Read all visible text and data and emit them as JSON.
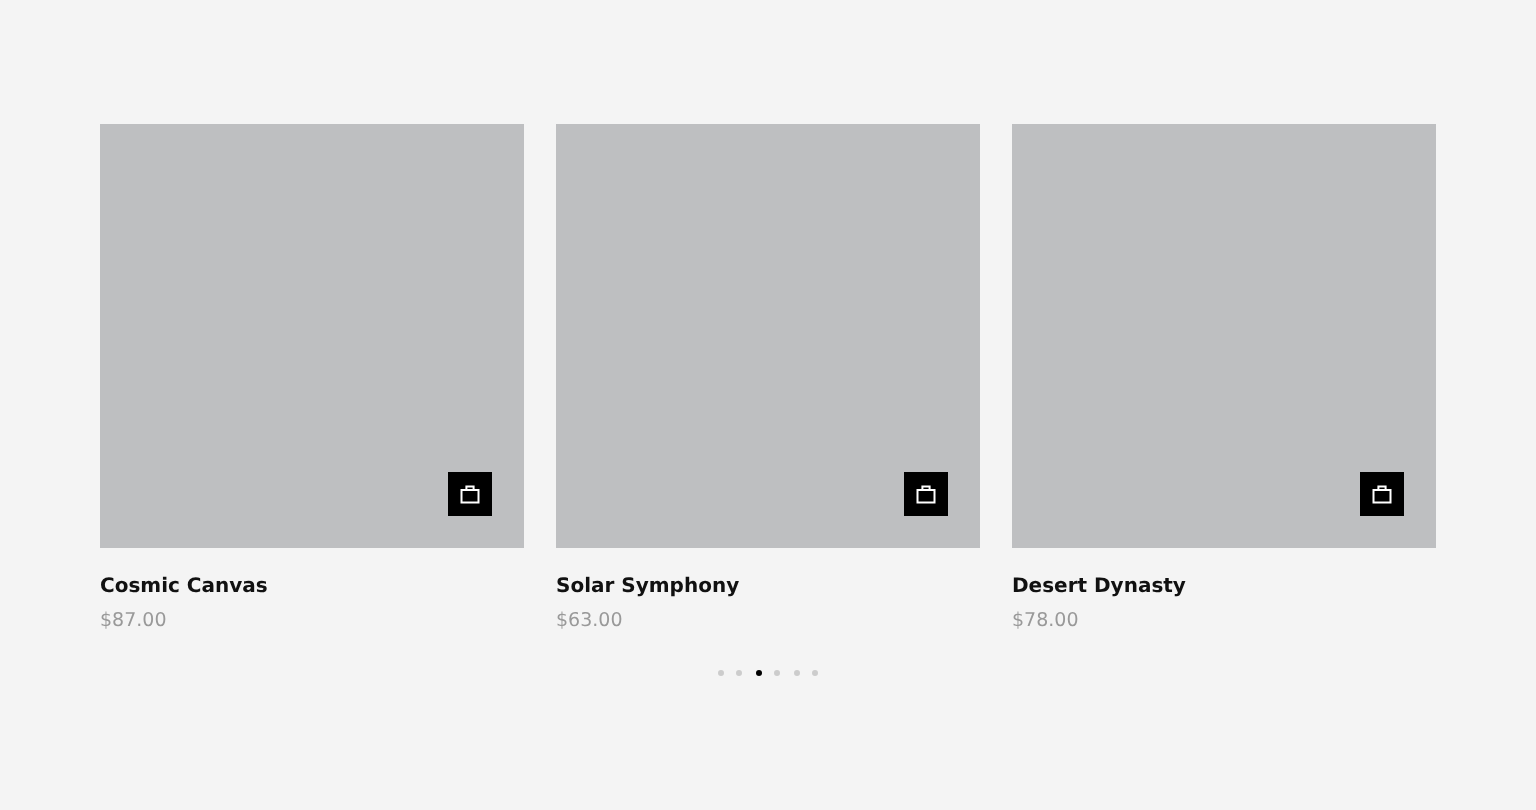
{
  "products": [
    {
      "name": "Cosmic Canvas",
      "price": "$87.00"
    },
    {
      "name": "Solar Symphony",
      "price": "$63.00"
    },
    {
      "name": "Desert Dynasty",
      "price": "$78.00"
    }
  ],
  "pagination": [
    {
      "selected": false
    },
    {
      "selected": false
    },
    {
      "selected": true
    },
    {
      "selected": false
    },
    {
      "selected": false
    },
    {
      "selected": false
    }
  ]
}
